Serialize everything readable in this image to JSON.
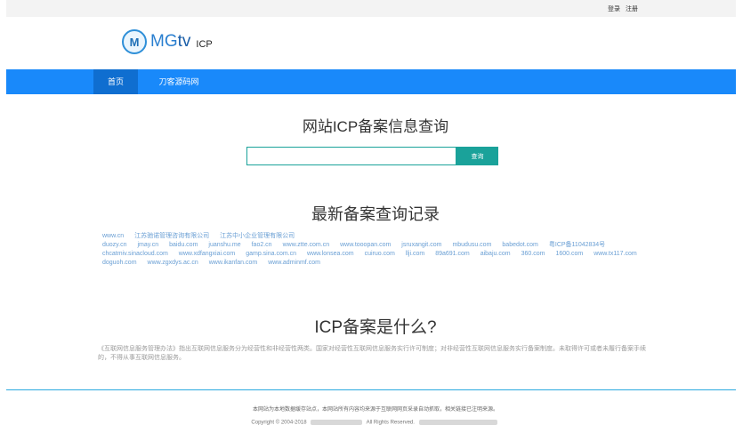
{
  "topbar": {
    "login": "登录",
    "register": "注册"
  },
  "logo": {
    "mark": "M",
    "brand_m": "MG",
    "brand_tv": "tv",
    "suffix": "ICP"
  },
  "nav": [
    {
      "label": "首页",
      "active": true
    },
    {
      "label": "刀客源码网",
      "active": false
    }
  ],
  "search": {
    "title": "网站ICP备案信息查询",
    "placeholder": "",
    "button": "查询"
  },
  "records": {
    "title": "最新备案查询记录",
    "rows": [
      [
        "www.cn",
        "江苏驰诺管理咨询有限公司",
        "江苏中小企业管理有限公司"
      ],
      [
        "duozy.cn",
        "jmay.cn",
        "baidu.com",
        "juanshu.me",
        "fao2.cn",
        "www.ztte.com.cn",
        "www.tooopan.com",
        "jsruxangit.com",
        "mbudusu.com",
        "babedot.com",
        "粤ICP备11042834号"
      ],
      [
        "chcatmiv.sinacloud.com",
        "www.xdfangxiai.com",
        "gamp.sina.com.cn",
        "www.lonsea.com",
        "cuiruo.com",
        "llji.com",
        "89a691.com",
        "aibaju.com",
        "360.com",
        "1600.com",
        "www.tx117.com"
      ],
      [
        "doguoh.com",
        "www.zgxdys.ac.cn",
        "www.ikanfan.com",
        "www.adminmf.com"
      ]
    ]
  },
  "about": {
    "title": "ICP备案是什么?",
    "text": "《互联网信息服务管理办法》指出互联网信息服务分为经营性和非经营性两类。国家对经营性互联网信息服务实行许可制度；对非经营性互联网信息服务实行备案制度。未取得许可或者未履行备案手续的，不得从事互联网信息服务。"
  },
  "footer": {
    "line1": "本网站为本地数据缓存站点，本网站所有内容均来源于互联网网页采录自动抓取，相关链接已注明来源。",
    "copyright_prefix": "Copyright © 2004-2018",
    "rights": "All Rights Reserved."
  },
  "colors": {
    "nav": "#1989fa",
    "nav_active": "#0f6ed0",
    "button": "#1aa29a",
    "link": "#6a9fd4"
  }
}
